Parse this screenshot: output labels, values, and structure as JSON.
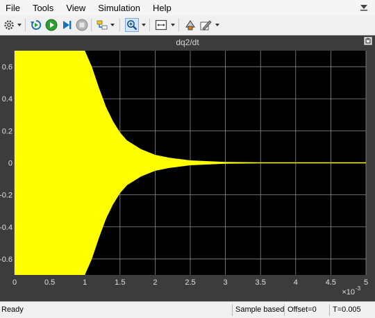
{
  "menubar": {
    "items": [
      "File",
      "Tools",
      "View",
      "Simulation",
      "Help"
    ]
  },
  "toolbar": {
    "icons": [
      "settings-icon",
      "step-back-icon",
      "run-icon",
      "step-forward-icon",
      "stop-icon",
      "highlight-icon",
      "zoom-in-icon",
      "autoscale-icon",
      "write-to-workspace-icon",
      "style-icon"
    ],
    "active": "zoom-in-icon"
  },
  "scope": {
    "title": "dq2/dt",
    "y_ticks": [
      "0.6",
      "0.4",
      "0.2",
      "0",
      "-0.2",
      "-0.4",
      "-0.6"
    ],
    "x_ticks": [
      "0",
      "0.5",
      "1",
      "1.5",
      "2",
      "2.5",
      "3",
      "3.5",
      "4",
      "4.5",
      "5"
    ],
    "x_exponent_base": "×10",
    "x_exponent_power": "-3",
    "colors": {
      "background": "#000000",
      "frame": "#3c3c3c",
      "grid": "#8c8c8c",
      "signal": "#ffff00",
      "text": "#e0e0e0"
    }
  },
  "chart_data": {
    "type": "area",
    "title": "dq2/dt",
    "xlabel": "",
    "ylabel": "",
    "x_scale_factor": "×10^-3",
    "xlim": [
      0,
      5
    ],
    "ylim": [
      -0.7,
      0.7
    ],
    "grid": true,
    "series": [
      {
        "x": [
          0,
          0.5,
          1.0,
          1.1,
          1.2,
          1.3,
          1.4,
          1.5,
          1.6,
          1.8,
          2.0,
          2.2,
          2.5,
          3.0,
          3.5,
          4.0,
          5.0
        ],
        "upper": [
          0.7,
          0.7,
          0.7,
          0.6,
          0.47,
          0.35,
          0.26,
          0.19,
          0.14,
          0.085,
          0.05,
          0.032,
          0.015,
          0.005,
          0.003,
          0.002,
          0.002
        ],
        "lower": [
          -0.7,
          -0.7,
          -0.7,
          -0.6,
          -0.47,
          -0.35,
          -0.26,
          -0.19,
          -0.14,
          -0.085,
          -0.05,
          -0.032,
          -0.015,
          -0.005,
          -0.003,
          -0.002,
          -0.002
        ]
      }
    ]
  },
  "status": {
    "state": "Ready",
    "mode": "Sample based",
    "offset": "Offset=0",
    "time": "T=0.005"
  }
}
